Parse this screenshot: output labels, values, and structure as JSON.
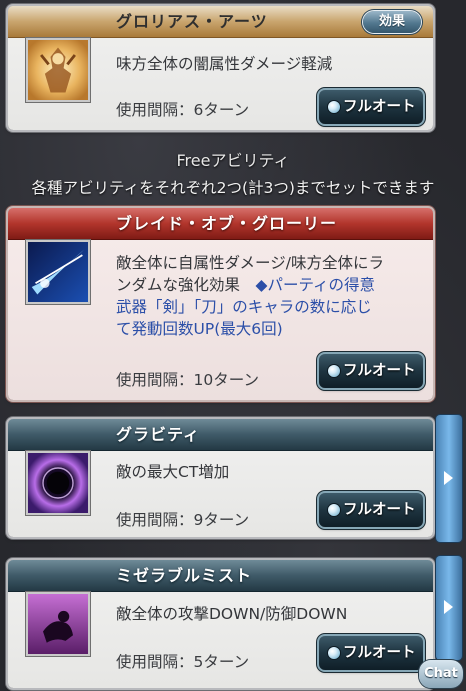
{
  "support": {
    "name": "グロリアス・アーツ",
    "effect_label": "効果",
    "description": "味方全体の闇属性ダメージ軽減",
    "cooldown": "使用間隔：6ターン",
    "fullauto_label": "フルオート",
    "icon": "golden-armor-figure-icon"
  },
  "free_section": {
    "title": "Freeアビリティ",
    "subtitle": "各種アビリティをそれぞれ2つ(計3つ)までセットできます"
  },
  "abilities": [
    {
      "name": "ブレイド・オブ・グローリー",
      "description_line1": "敵全体に自属性ダメージ/味方全体にラ",
      "description_line2": "ンダムな強化効果",
      "description_blue_inline": "◆パーティの得意",
      "description_blue_line3": "武器「剣」「刀」のキャラの数に応じ",
      "description_blue_line4": "て発動回数UP(最大6回)",
      "cooldown": "使用間隔：10ターン",
      "fullauto_label": "フルオート",
      "icon": "blue-blade-slash-icon",
      "header_color": "#b2352c"
    },
    {
      "name": "グラビティ",
      "description_line1": "敵の最大CT増加",
      "cooldown": "使用間隔：9ターン",
      "fullauto_label": "フルオート",
      "icon": "dark-purple-orb-icon",
      "header_color": "#3f5a68"
    },
    {
      "name": "ミゼラブルミスト",
      "description_line1": "敵全体の攻撃DOWN/防御DOWN",
      "cooldown": "使用間隔：5ターン",
      "fullauto_label": "フルオート",
      "icon": "purple-mist-figure-icon",
      "header_color": "#3f5a68"
    }
  ],
  "chat_label": "Chat",
  "colors": {
    "support_header": "#c9a56e",
    "blue_text": "#2c4fa8",
    "fullauto_bg": "#1e3440",
    "scroll_tab": "#79b8ea"
  }
}
